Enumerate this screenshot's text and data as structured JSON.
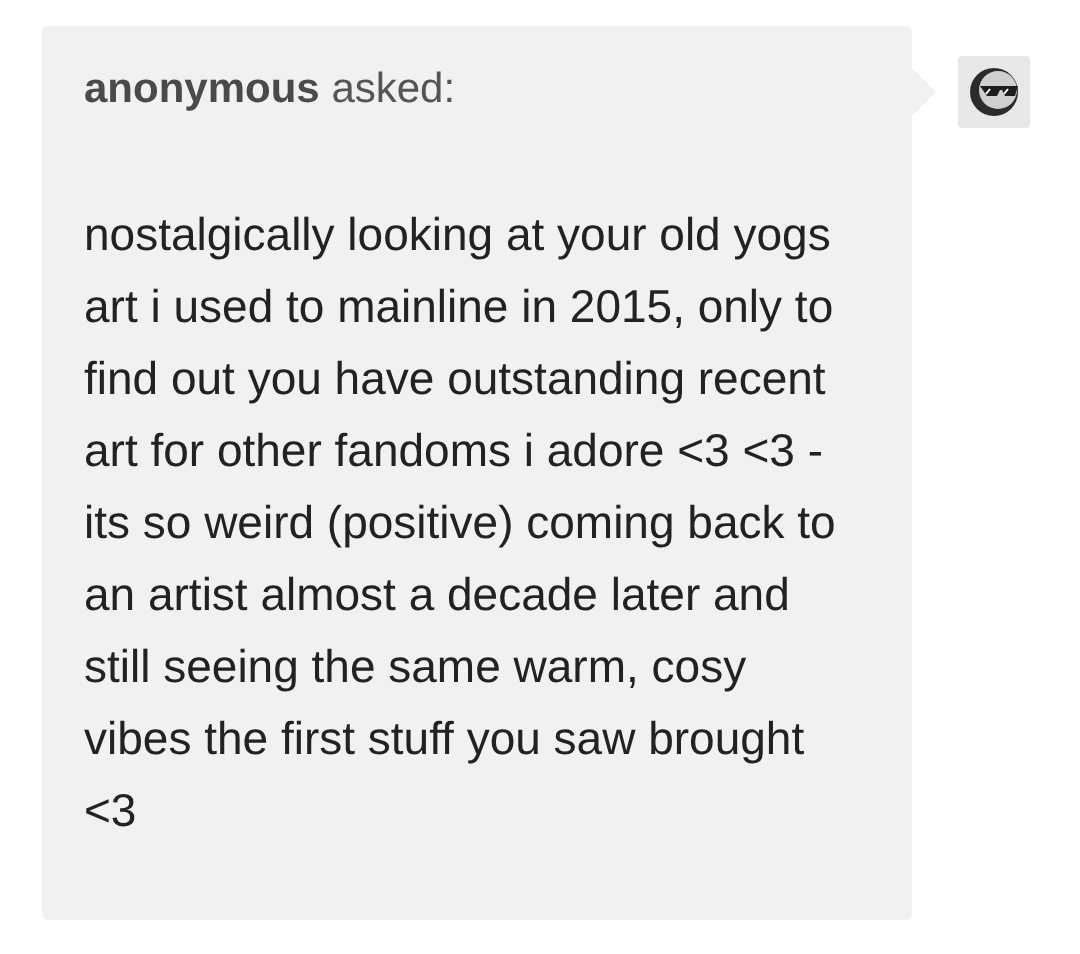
{
  "ask": {
    "header": "**anonymous** asked:",
    "body": "nostalgically looking at your old yogs art i used to mainline in 2015, only to find out you have outstanding recent art for other fandoms i adore <3 <3 - its so weird (positive) coming back to an artist almost a decade later and still seeing the same warm, cosy vibes the first stuff you saw brought <3"
  }
}
